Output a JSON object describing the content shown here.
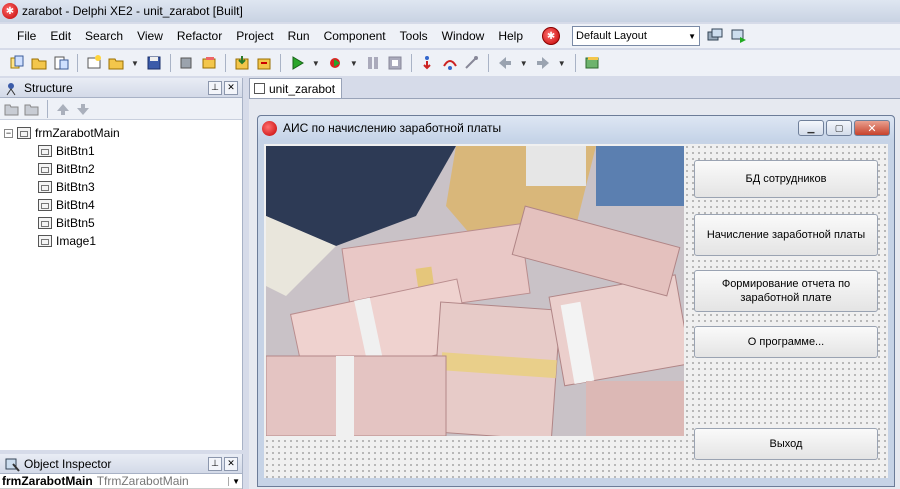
{
  "window": {
    "title": "zarabot - Delphi XE2 - unit_zarabot [Built]"
  },
  "menu": [
    "File",
    "Edit",
    "Search",
    "View",
    "Refactor",
    "Project",
    "Run",
    "Component",
    "Tools",
    "Window",
    "Help"
  ],
  "layout": {
    "selected": "Default Layout"
  },
  "structure": {
    "title": "Structure",
    "root": "frmZarabotMain",
    "children": [
      "BitBtn1",
      "BitBtn2",
      "BitBtn3",
      "BitBtn4",
      "BitBtn5",
      "Image1"
    ]
  },
  "object_inspector": {
    "title": "Object Inspector",
    "selected_name": "frmZarabotMain",
    "selected_type": "TfrmZarabotMain"
  },
  "editor": {
    "tab": "unit_zarabot"
  },
  "form": {
    "caption": "АИС по начислению заработной платы",
    "buttons": [
      "БД сотрудников",
      "Начисление заработной платы",
      "Формирование отчета по заработной плате",
      "О программе...",
      "Выход"
    ]
  },
  "colors": {
    "accent_red": "#c30000",
    "panel_bg": "#d6dbe9"
  }
}
